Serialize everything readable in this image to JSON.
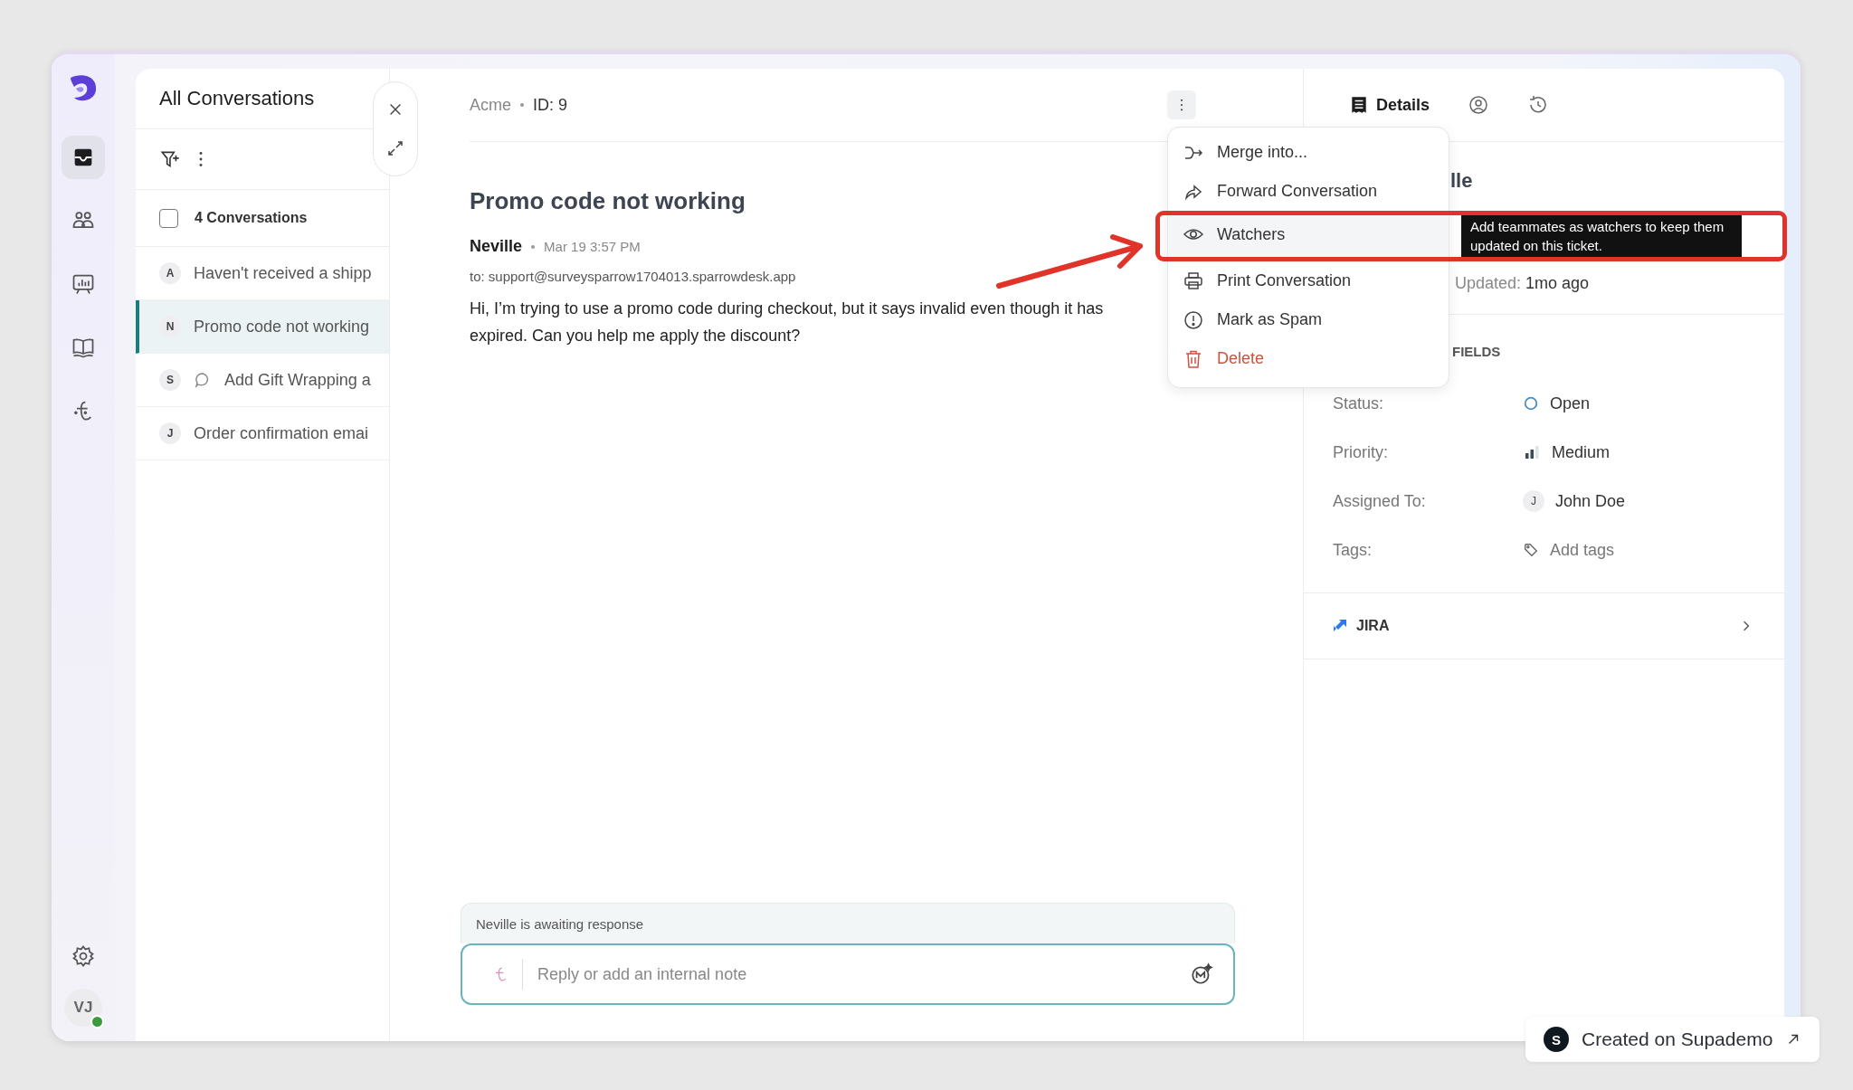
{
  "nav": {
    "items": [
      {
        "kind": "inbox",
        "selected": true
      },
      {
        "kind": "contacts",
        "selected": false
      },
      {
        "kind": "reports",
        "selected": false
      },
      {
        "kind": "knowledge",
        "selected": false
      },
      {
        "kind": "bot",
        "selected": false
      }
    ],
    "avatar": {
      "initials": "VJ",
      "online": true
    }
  },
  "conversation_list": {
    "title": "All Conversations",
    "count_label": "4 Conversations",
    "select_all_checked": false,
    "items": [
      {
        "avatar": "A",
        "title": "Haven't received a shipp",
        "kind": "plain",
        "selected": false
      },
      {
        "avatar": "N",
        "title": "Promo code not working",
        "kind": "plain",
        "selected": true
      },
      {
        "avatar": "S",
        "title": "Add Gift Wrapping a",
        "kind": "chat",
        "selected": false
      },
      {
        "avatar": "J",
        "title": "Order confirmation emai",
        "kind": "plain",
        "selected": false
      }
    ]
  },
  "conversation": {
    "company": "Acme",
    "id_label": "ID: 9",
    "subject": "Promo code not working",
    "message": {
      "sender": "Neville",
      "time": "Mar 19 3:57 PM",
      "to": "to: support@surveysparrow1704013.sparrowdesk.app",
      "body_lines": [
        "Hi, I’m trying to use a promo code during checkout, but it says invalid even though it has",
        "expired. Can you help me apply the discount?"
      ]
    },
    "composer": {
      "status": "Neville is awaiting response",
      "placeholder": "Reply or add an internal note"
    }
  },
  "menu": {
    "items": [
      {
        "kind": "merge",
        "label": "Merge into...",
        "selected": false
      },
      {
        "kind": "forward",
        "label": "Forward Conversation",
        "selected": false
      },
      {
        "kind": "watchers",
        "label": "Watchers",
        "selected": true
      },
      {
        "kind": "print",
        "label": "Print Conversation",
        "selected": false
      },
      {
        "kind": "spam",
        "label": "Mark as Spam",
        "selected": false
      },
      {
        "kind": "delete",
        "label": "Delete",
        "selected": false
      }
    ],
    "tooltip": "Add teammates as watchers to keep them updated on this ticket."
  },
  "details": {
    "tabs": [
      {
        "kind": "details",
        "label": "Details",
        "selected": true
      },
      {
        "kind": "contact",
        "selected": false
      },
      {
        "kind": "history",
        "selected": false
      }
    ],
    "name_fragment": "lle",
    "updated_label": "Updated:",
    "updated_value": "1mo ago",
    "fields_heading": "FIELDS",
    "fields": [
      {
        "kind": "status",
        "label": "Status:",
        "value": "Open"
      },
      {
        "kind": "priority",
        "label": "Priority:",
        "value": "Medium"
      },
      {
        "kind": "assignee",
        "label": "Assigned To:",
        "value": "John Doe",
        "initial": "J"
      },
      {
        "kind": "tags",
        "label": "Tags:",
        "value": "Add tags"
      }
    ],
    "integrations": [
      {
        "name": "JIRA"
      }
    ]
  },
  "badge": {
    "initial": "S",
    "text": "Created on Supademo"
  }
}
